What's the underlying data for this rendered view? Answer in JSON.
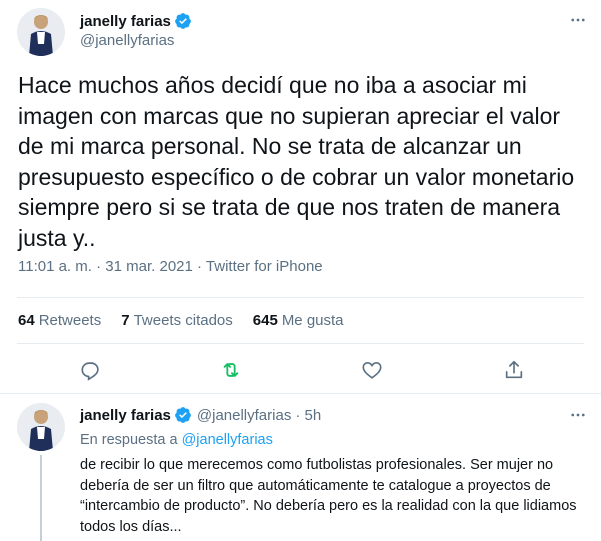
{
  "main_tweet": {
    "display_name": "janelly farias",
    "handle": "@janellyfarias",
    "text": "Hace muchos años decidí que no iba a asociar mi imagen con marcas que no supieran apreciar el valor de mi marca personal. No se trata de alcanzar un presupuesto específico o de cobrar un valor monetario siempre pero si se trata de que nos traten de manera justa y..",
    "time": "11:01 a. m.",
    "separator": "·",
    "date": "31 mar. 2021",
    "source": "Twitter for iPhone",
    "stats": {
      "retweets_count": "64",
      "retweets_label": "Retweets",
      "quotes_count": "7",
      "quotes_label": "Tweets citados",
      "likes_count": "645",
      "likes_label": "Me gusta"
    }
  },
  "reply_tweet": {
    "display_name": "janelly farias",
    "handle": "@janellyfarias",
    "time_ago": "· 5h",
    "reply_prefix": "En respuesta a",
    "reply_to": "@janellyfarias",
    "text": "de recibir lo que merecemos como futbolistas profesionales. Ser mujer no debería de ser un filtro que automáticamente te catalogue a proyectos de “intercambio de producto”. No debería pero es la realidad con la que lidiamos todos los días..."
  },
  "icons": {
    "verified": "verified-badge-icon",
    "more": "more-dots-icon",
    "reply": "reply-icon",
    "retweet": "retweet-icon",
    "like": "like-heart-icon",
    "share": "share-icon"
  },
  "colors": {
    "accent": "#1da1f2",
    "retweet_green": "#17bf63",
    "secondary_text": "#5b7083",
    "divider": "#e6ecf0"
  }
}
